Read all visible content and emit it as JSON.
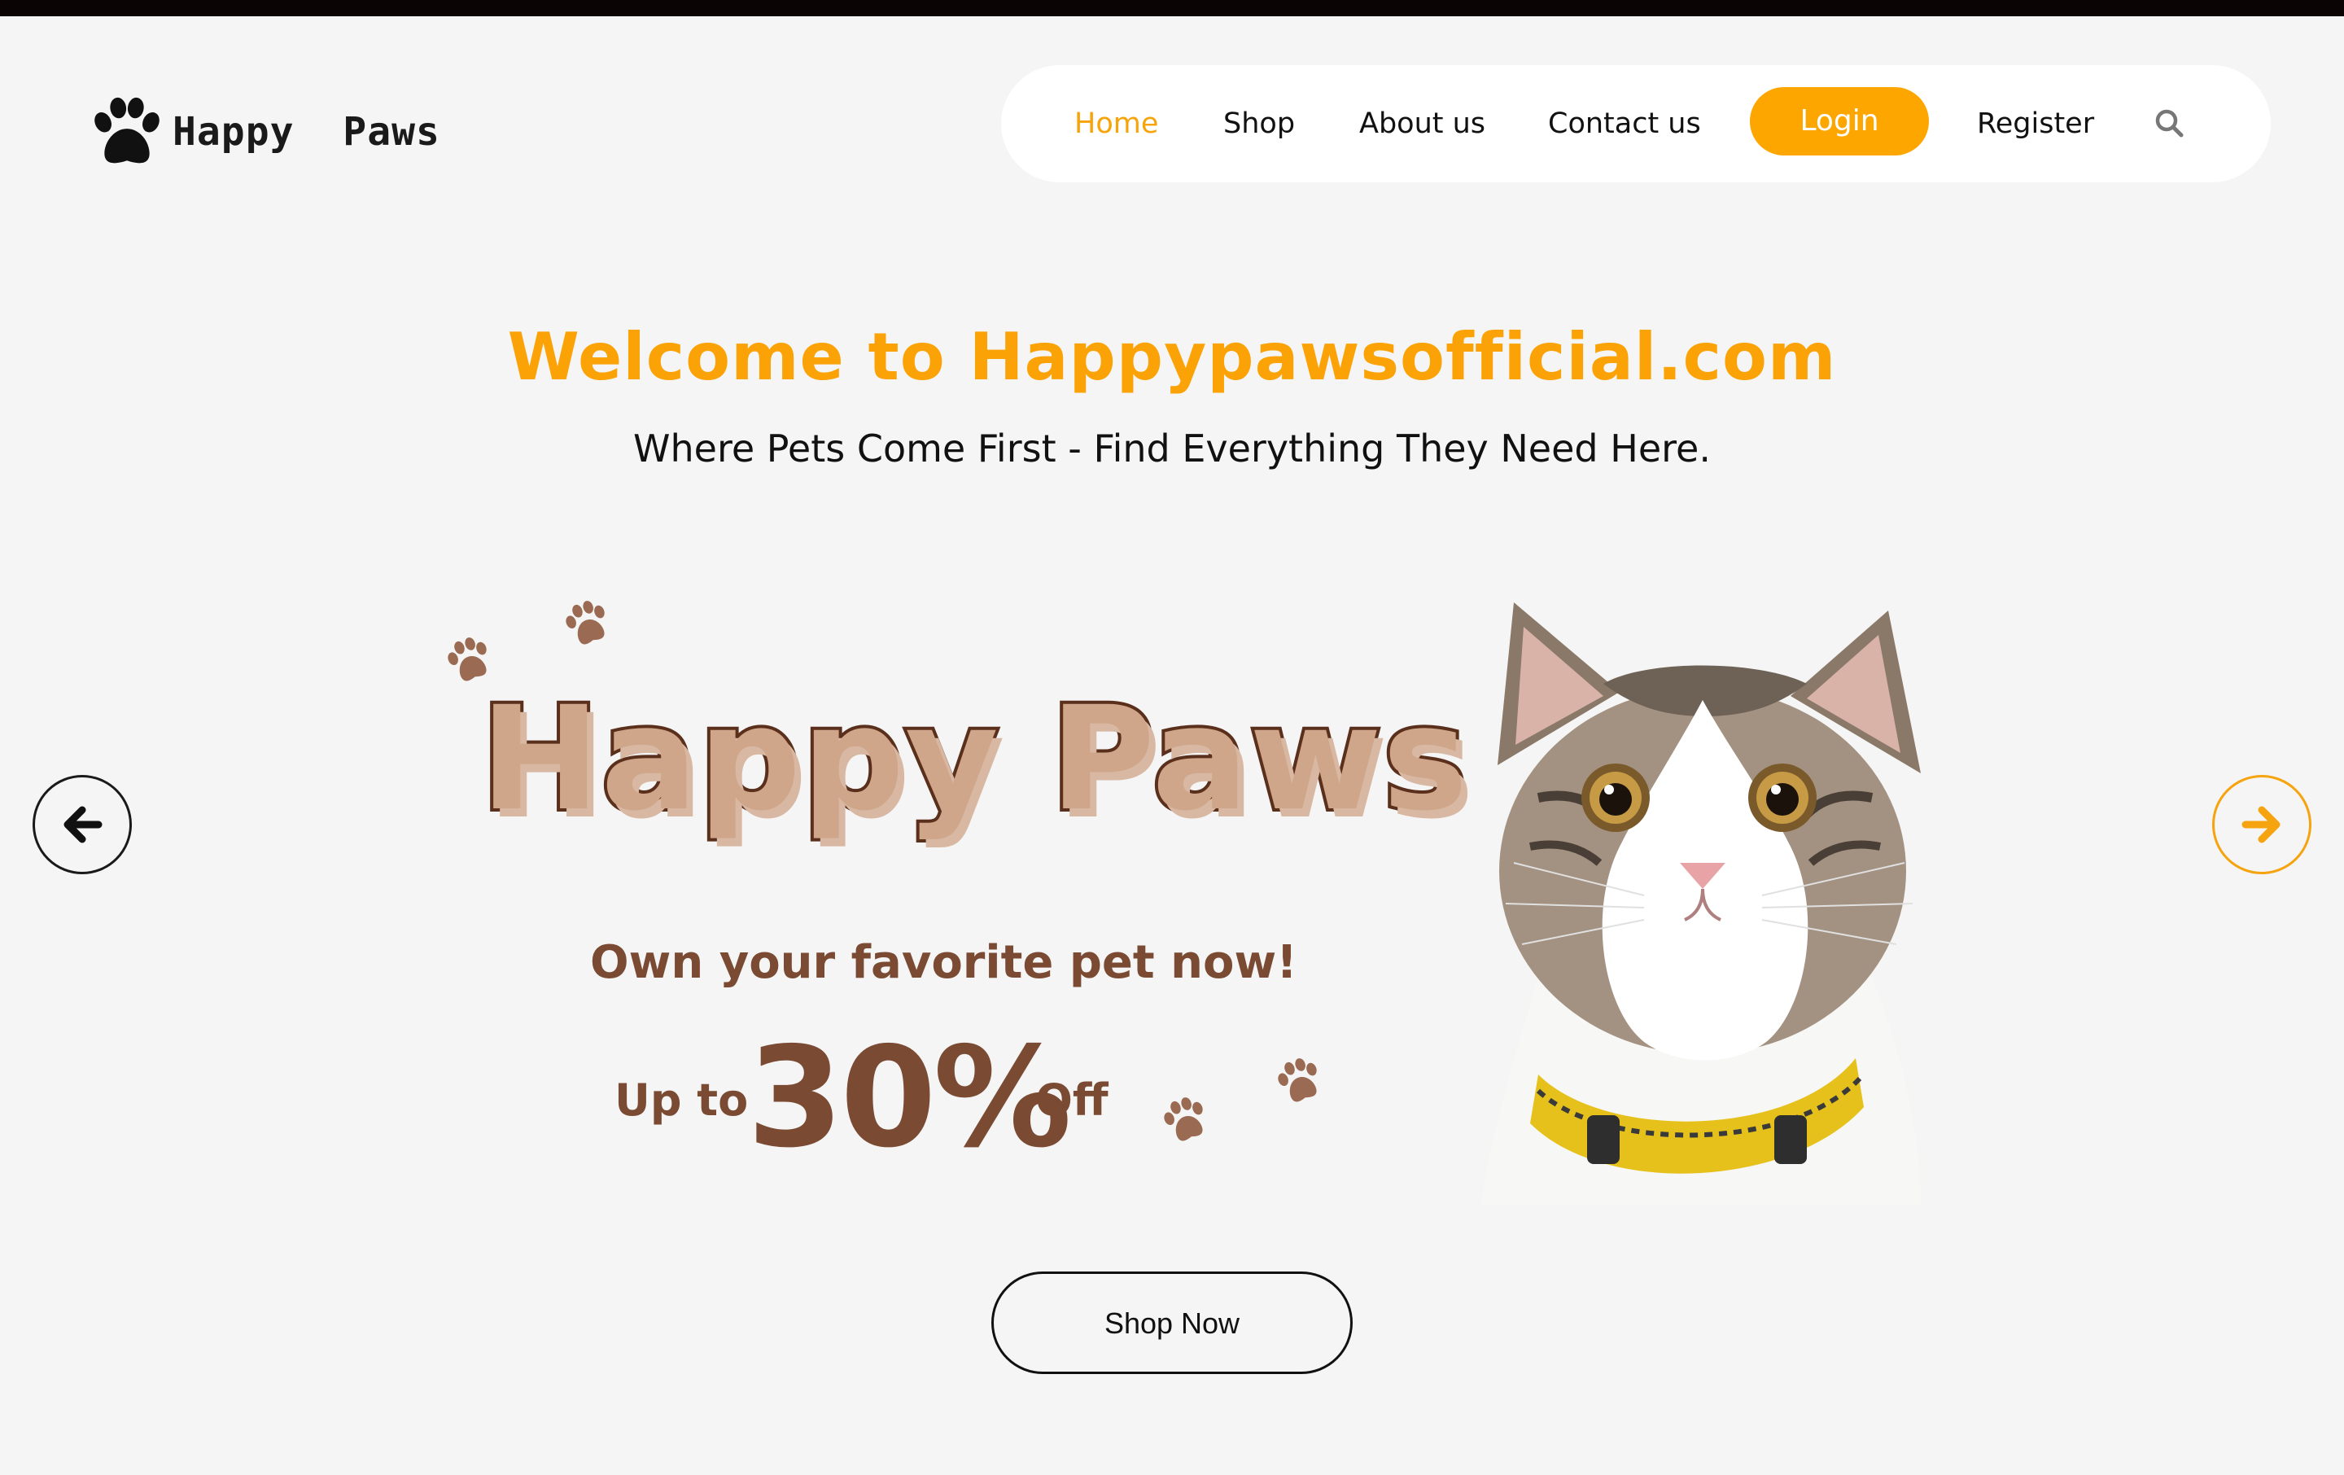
{
  "brand": {
    "name": "Happy  Paws",
    "logo_icon": "paw-icon"
  },
  "nav": {
    "items": [
      {
        "label": "Home",
        "active": true
      },
      {
        "label": "Shop",
        "active": false
      },
      {
        "label": "About us",
        "active": false
      },
      {
        "label": "Contact us",
        "active": false
      }
    ],
    "login_label": "Login",
    "register_label": "Register",
    "search_icon": "search-icon"
  },
  "hero": {
    "title": "Welcome to Happypawsofficial.com",
    "subtitle": "Where Pets Come First - Find Everything They Need Here."
  },
  "banner": {
    "brand": "Happy Paws",
    "tagline": "Own your favorite pet now!",
    "discount_prefix": "Up to",
    "discount_value": "30%",
    "discount_suffix": "Off",
    "image": "cat-with-yellow-collar"
  },
  "carousel": {
    "prev_icon": "arrow-left-icon",
    "next_icon": "arrow-right-icon"
  },
  "cta": {
    "label": "Shop Now"
  },
  "colors": {
    "accent": "#fba306",
    "background": "#f4f5f4",
    "banner_brown": "#7a4a33",
    "text": "#111111"
  }
}
